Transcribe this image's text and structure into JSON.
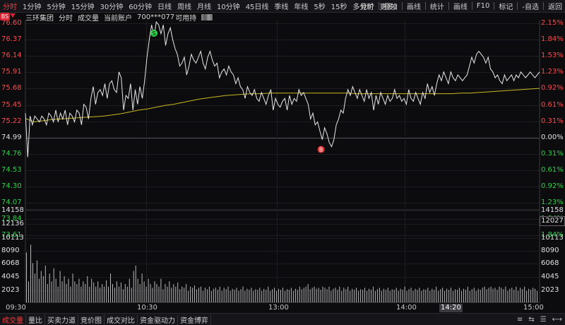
{
  "toolbar": {
    "tabs": [
      "分时",
      "1分钟",
      "5分钟",
      "15分钟",
      "30分钟",
      "60分钟",
      "日线",
      "周线",
      "月线",
      "10分钟",
      "45日线",
      "季线",
      "年线",
      "5秒",
      "15秒",
      "多分时",
      "更多〉"
    ],
    "active_tab": "分时",
    "right_tools": [
      "竞价",
      "叠加",
      "画线",
      "统计",
      "画线",
      "F10",
      "标记",
      "-自选",
      "返回"
    ]
  },
  "info": {
    "stock_name": "三环集团",
    "mode": "分时",
    "volume_label": "成交量",
    "account_label": "当前账户",
    "account_no": "700***077",
    "available_label": "可用持"
  },
  "badge": "BS",
  "price_axis": {
    "prices": [
      "76.60",
      "76.37",
      "76.14",
      "75.91",
      "75.68",
      "75.45",
      "75.22",
      "74.99",
      "74.76",
      "74.53",
      "74.30",
      "74.07",
      "73.84",
      "73.61"
    ],
    "percents": [
      "2.15%",
      "1.84%",
      "1.53%",
      "1.23%",
      "0.92%",
      "0.61%",
      "0.31%",
      "0.00%",
      "0.31%",
      "0.61%",
      "0.92%",
      "1.23%",
      "1.84%",
      "1.84%"
    ],
    "ref_index": 7,
    "min": 73.55,
    "max": 76.6
  },
  "volume_axis": {
    "left": [
      "14158",
      "12136",
      "10113",
      "8090",
      "6068",
      "4045",
      "2023"
    ],
    "right": [
      "14158",
      "12027",
      "10113",
      "8090",
      "6068",
      "4045",
      "2023"
    ],
    "current_vol": "12027",
    "max": 14158
  },
  "time_axis": {
    "labels": [
      "09:30",
      "10:30",
      "13:00",
      "14:00",
      "15:00"
    ],
    "highlight": "14:20"
  },
  "bottom": {
    "tabs": [
      "成交量",
      "量比",
      "买卖力道",
      "竞价图",
      "成交对比",
      "资金驱动力",
      "资金博弈"
    ],
    "active_tab": "成交量",
    "right_icons": [
      "≡",
      "⇆",
      "☰",
      "⟷"
    ]
  },
  "markers": [
    {
      "label": "S",
      "t": 0.25,
      "price": 76.48
    },
    {
      "label": "B",
      "t": 0.575,
      "price": 74.48
    }
  ],
  "colors": {
    "up": "#ff4a4a",
    "down": "#2fd14a",
    "price_line": "#e8e8e8",
    "avg_line": "#c8b820",
    "vol_bar": "#b8b8b8"
  },
  "chart_data": {
    "type": "line",
    "x_label": "time",
    "y_label": "price",
    "series": [
      {
        "name": "",
        "values": [
          75.05,
          74.3,
          75.0,
          74.85,
          75.0,
          74.95,
          74.9,
          75.0,
          74.95,
          74.85,
          75.05,
          75.0,
          74.9,
          75.1,
          74.9,
          75.05,
          74.95,
          75.1,
          74.85,
          75.05,
          75.0,
          74.9,
          75.1,
          75.05,
          74.85,
          75.2,
          75.15,
          74.95,
          75.3,
          75.5,
          75.2,
          75.4,
          75.45,
          75.35,
          75.55,
          75.3,
          75.55,
          75.6,
          75.45,
          75.4,
          75.75,
          75.65,
          75.1,
          75.35,
          75.3,
          75.55,
          75.1,
          75.45,
          75.2,
          75.5,
          75.3,
          75.6,
          76.0,
          76.3,
          76.55,
          76.35,
          76.6,
          76.55,
          76.4,
          76.55,
          76.2,
          76.4,
          76.5,
          76.3,
          76.15,
          76.05,
          75.85,
          75.9,
          76.0,
          75.7,
          75.85,
          76.05,
          75.95,
          75.9,
          76.0,
          76.1,
          75.9,
          75.8,
          76.0,
          76.1,
          75.95,
          75.85,
          75.9,
          75.65,
          75.75,
          75.8,
          75.7,
          75.85,
          75.75,
          75.7,
          75.55,
          75.65,
          75.5,
          75.45,
          75.3,
          75.5,
          75.4,
          75.35,
          75.45,
          75.3,
          75.25,
          75.4,
          75.3,
          75.2,
          75.35,
          75.45,
          75.1,
          75.3,
          75.2,
          75.15,
          75.25,
          75.3,
          75.1,
          75.35,
          75.2,
          75.3,
          75.25,
          75.45,
          75.35,
          75.4,
          75.3,
          75.2,
          74.95,
          75.05,
          74.85,
          74.9,
          74.75,
          74.6,
          74.8,
          74.7,
          74.55,
          74.48,
          74.6,
          74.85,
          74.95,
          75.1,
          75.05,
          75.3,
          75.45,
          75.35,
          75.5,
          75.4,
          75.3,
          75.45,
          75.35,
          75.25,
          75.45,
          75.3,
          75.4,
          75.1,
          75.35,
          75.2,
          75.4,
          75.3,
          75.2,
          75.35,
          75.25,
          75.3,
          75.45,
          75.3,
          75.35,
          75.25,
          75.3,
          75.2,
          75.45,
          75.3,
          75.25,
          75.4,
          75.3,
          75.2,
          75.4,
          75.3,
          75.55,
          75.4,
          75.5,
          75.35,
          75.55,
          75.7,
          75.6,
          75.75,
          75.65,
          75.55,
          75.75,
          75.65,
          75.6,
          75.7,
          75.65,
          75.6,
          75.65,
          75.7,
          75.85,
          76.0,
          75.9,
          76.05,
          76.1,
          76.05,
          76.0,
          75.9,
          76.0,
          75.8,
          75.75,
          75.65,
          75.7,
          75.6,
          75.55,
          75.7,
          75.6,
          75.65,
          75.7,
          75.6,
          75.7,
          75.65,
          75.75,
          75.7,
          75.65,
          75.7,
          75.75,
          75.7,
          75.65,
          75.7,
          75.75
        ]
      },
      {
        "name": "",
        "values": [
          74.96,
          74.9,
          74.92,
          74.94,
          74.95,
          74.96,
          74.97,
          74.98,
          74.99,
          75.0,
          75.02,
          75.04,
          75.07,
          75.1,
          75.12,
          75.15,
          75.18,
          75.2,
          75.23,
          75.26,
          75.29,
          75.31,
          75.33,
          75.35,
          75.36,
          75.37,
          75.38,
          75.38,
          75.39,
          75.39,
          75.39,
          75.39,
          75.39,
          75.39,
          75.39,
          75.39,
          75.39,
          75.39,
          75.38,
          75.38,
          75.38,
          75.38,
          75.38,
          75.38,
          75.38,
          75.38,
          75.38,
          75.38,
          75.38,
          75.38,
          75.39,
          75.39,
          75.4,
          75.41,
          75.42,
          75.43,
          75.44,
          75.45,
          75.46,
          75.47
        ]
      }
    ],
    "volume": [
      95,
      40,
      110,
      75,
      55,
      80,
      45,
      60,
      50,
      70,
      35,
      55,
      40,
      65,
      45,
      30,
      60,
      40,
      50,
      35,
      45,
      30,
      55,
      40,
      35,
      45,
      30,
      40,
      35,
      50,
      30,
      45,
      38,
      30,
      40,
      28,
      35,
      30,
      42,
      30,
      55,
      35,
      28,
      40,
      30,
      38,
      25,
      35,
      30,
      45,
      28,
      60,
      70,
      45,
      35,
      55,
      40,
      30,
      45,
      35,
      28,
      40,
      35,
      30,
      45,
      25,
      35,
      30,
      40,
      28,
      35,
      30,
      38,
      25,
      30,
      28,
      35,
      22,
      30,
      28,
      32,
      25,
      28,
      30,
      22,
      28,
      25,
      30,
      22,
      26,
      28,
      24,
      30,
      22,
      28,
      25,
      30,
      22,
      26,
      24,
      28,
      22,
      25,
      30,
      22,
      26,
      24,
      28,
      22,
      25,
      24,
      28,
      22,
      26,
      24,
      30,
      22,
      25,
      28,
      22,
      26,
      24,
      28,
      22,
      25,
      24,
      28,
      22,
      26,
      24,
      30,
      25,
      28,
      30,
      35,
      25,
      28,
      30,
      26,
      28,
      24,
      30,
      28,
      25,
      30,
      22,
      26,
      28,
      24,
      30,
      22,
      28,
      25,
      30,
      22,
      26,
      24,
      28,
      22,
      25,
      24,
      28,
      22,
      26,
      24,
      30,
      22,
      25,
      28,
      22,
      26,
      24,
      28,
      22,
      25,
      24,
      28,
      22,
      26,
      24,
      30,
      22,
      25,
      28,
      22,
      26,
      24,
      28,
      22,
      25,
      24,
      28,
      22,
      26,
      24,
      30,
      22,
      25,
      28,
      22,
      26,
      24,
      28,
      22,
      25,
      24,
      28,
      22,
      26,
      24,
      30,
      22,
      25,
      28,
      22,
      26,
      24,
      28,
      30,
      25,
      28,
      30,
      26,
      28,
      24,
      30,
      28,
      25,
      30,
      22,
      26,
      28,
      24,
      30,
      22,
      28,
      25,
      30,
      22,
      26,
      24,
      28,
      26,
      22
    ]
  }
}
